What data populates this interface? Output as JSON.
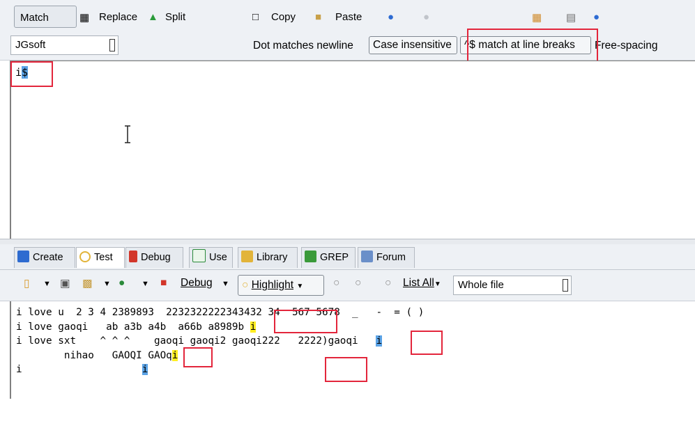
{
  "toolbar": {
    "match_label": "Match",
    "replace_label": "Replace",
    "split_label": "Split",
    "copy_label": "Copy",
    "paste_label": "Paste"
  },
  "options": {
    "flavor": "JGsoft",
    "dot_matches_newline": "Dot matches newline",
    "case_insensitive": "Case insensitive",
    "match_at_line_breaks": "^$ match at line breaks",
    "free_spacing": "Free-spacing"
  },
  "regex": {
    "char": "i",
    "anchor": "$"
  },
  "tabs": [
    {
      "label": "Create"
    },
    {
      "label": "Test"
    },
    {
      "label": "Debug"
    },
    {
      "label": "Use"
    },
    {
      "label": "Library"
    },
    {
      "label": "GREP"
    },
    {
      "label": "Forum"
    }
  ],
  "test_toolbar": {
    "debug_label": "Debug",
    "highlight_label": "Highlight",
    "list_all_label": "List All",
    "scope": "Whole file"
  },
  "test_lines": {
    "line1": "i love u  2 3 4 2389893  2232322222343432 34  567 5678  _   -  = ( )",
    "line2_prefix": "i love gaoqi   ab a3b a4b  a66b a8989b ",
    "line2_match": "i",
    "line3_prefix": "i love sxt    ^ ^ ^    gaoqi gaoqi2 gaoqi222   2222)gaoqi   ",
    "line3_match": "i",
    "line4_prefix": "        nihao   GAOQI GAOq",
    "line4_match": "i",
    "line5_prefix": "i",
    "line5_gap": "                    ",
    "line5_match": "i"
  },
  "colors": {
    "match_yellow": "#ffee22",
    "match_blue": "#5ba3e6",
    "annotation_red": "#e3253b"
  }
}
